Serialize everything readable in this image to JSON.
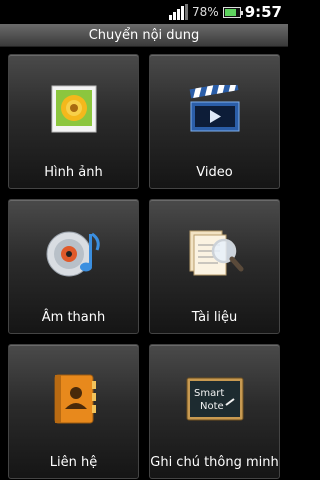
{
  "status": {
    "battery_percent": "78%",
    "battery_level": 0.78,
    "time": "9:57",
    "signal_icon": "signal-icon",
    "battery_icon": "battery-icon"
  },
  "header": {
    "title": "Chuyển nội dung"
  },
  "tiles": [
    {
      "label": "Hình ảnh",
      "icon": "photo-icon"
    },
    {
      "label": "Video",
      "icon": "clapperboard-icon"
    },
    {
      "label": "Âm thanh",
      "icon": "music-disc-icon"
    },
    {
      "label": "Tài liệu",
      "icon": "document-search-icon"
    },
    {
      "label": "Liên hệ",
      "icon": "contacts-book-icon"
    },
    {
      "label": "Ghi chú thông minh",
      "icon": "smart-note-icon",
      "icon_text": [
        "Smart",
        "Note"
      ]
    }
  ],
  "colors": {
    "battery_fill": "#5fd35f",
    "titlebar_top": "#6b6b6b",
    "titlebar_bottom": "#3a3a3a"
  }
}
